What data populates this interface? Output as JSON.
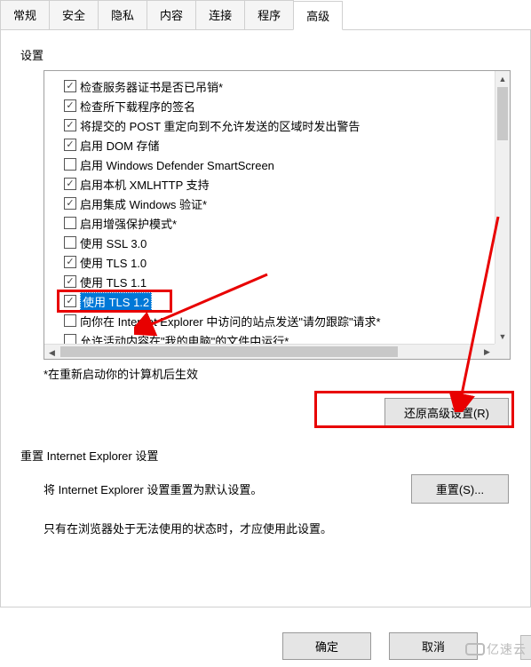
{
  "tabs": [
    "常规",
    "安全",
    "隐私",
    "内容",
    "连接",
    "程序",
    "高级"
  ],
  "active_tab_index": 6,
  "settings_label": "设置",
  "checks": [
    {
      "checked": true,
      "label": "检查服务器证书是否已吊销*"
    },
    {
      "checked": true,
      "label": "检查所下载程序的签名"
    },
    {
      "checked": true,
      "label": "将提交的 POST 重定向到不允许发送的区域时发出警告"
    },
    {
      "checked": true,
      "label": "启用 DOM 存储"
    },
    {
      "checked": false,
      "label": "启用 Windows Defender SmartScreen"
    },
    {
      "checked": true,
      "label": "启用本机 XMLHTTP 支持"
    },
    {
      "checked": true,
      "label": "启用集成 Windows 验证*"
    },
    {
      "checked": false,
      "label": "启用增强保护模式*"
    },
    {
      "checked": false,
      "label": "使用 SSL 3.0"
    },
    {
      "checked": true,
      "label": "使用 TLS 1.0"
    },
    {
      "checked": true,
      "label": "使用 TLS 1.1"
    },
    {
      "checked": true,
      "label": "使用 TLS 1.2",
      "highlight": true
    },
    {
      "checked": false,
      "label": "向你在 Internet Explorer 中访问的站点发送\"请勿跟踪\"请求*"
    },
    {
      "checked": false,
      "label": "允许活动内容在\"我的电脑\"的文件中运行*"
    }
  ],
  "restart_note": "*在重新启动你的计算机后生效",
  "restore_button": "还原高级设置(R)",
  "reset_group_label": "重置 Internet Explorer 设置",
  "reset_text": "将 Internet Explorer 设置重置为默认设置。",
  "reset_button": "重置(S)...",
  "reset_info": "只有在浏览器处于无法使用的状态时，才应使用此设置。",
  "ok_button": "确定",
  "cancel_button": "取消",
  "watermark": "亿速云",
  "colors": {
    "accent": "#e80000",
    "highlight_bg": "#0078d7"
  }
}
